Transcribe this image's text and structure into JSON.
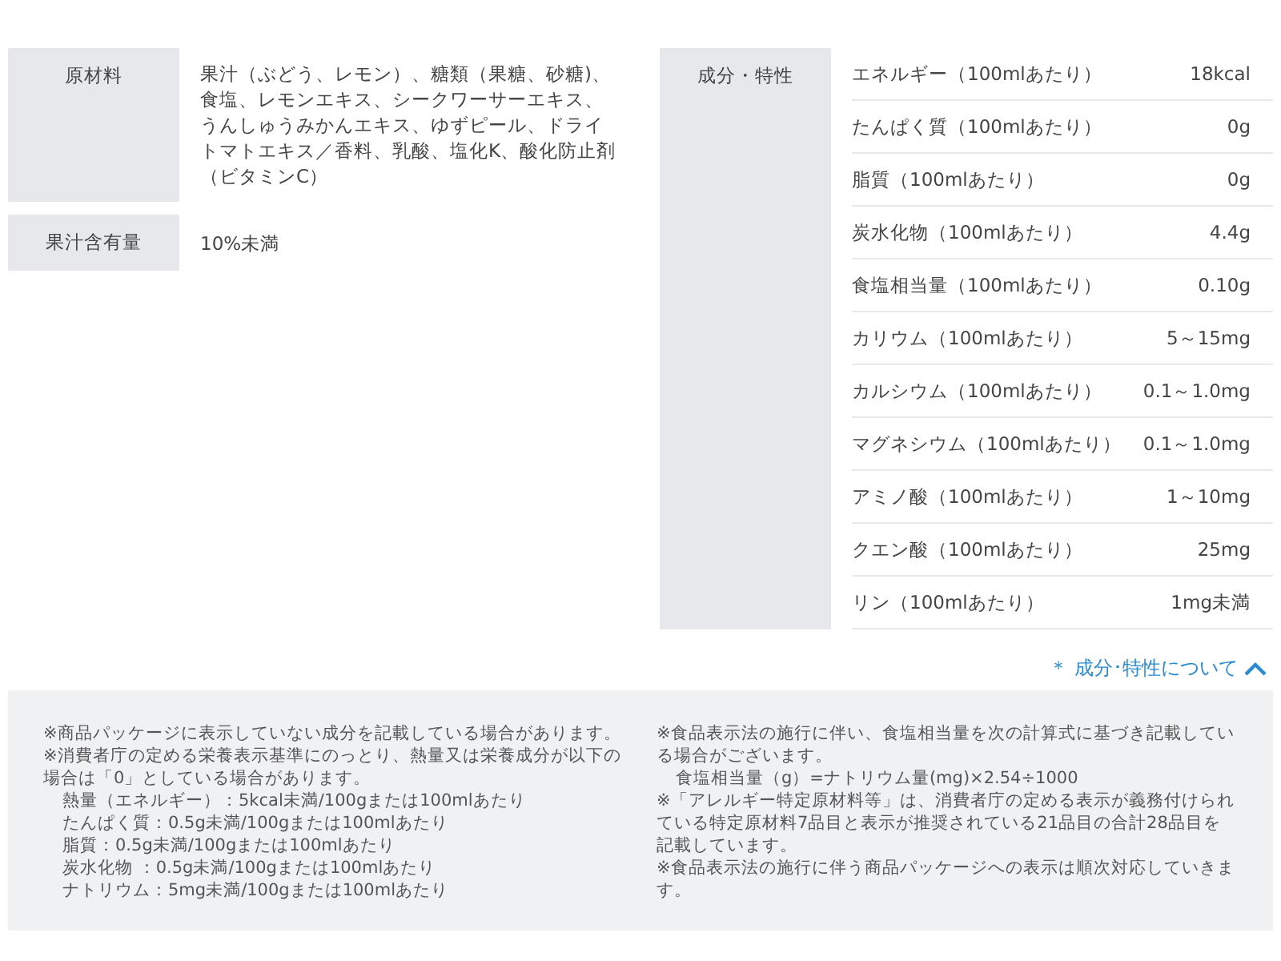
{
  "left_specs": [
    {
      "label": "原材料",
      "value": "果汁（ぶどう、レモン）、糖類（果糖、砂糖)、食塩、レモンエキス、シークワーサーエキス、うんしゅうみかんエキス、ゆずピール、ドライトマトエキス／香料、乳酸、塩化K、酸化防止剤（ビタミンC）"
    },
    {
      "label": "果汁含有量",
      "value": "10%未満"
    }
  ],
  "nutrition": {
    "label": "成分・特性",
    "rows": [
      {
        "name": "エネルギー（100mlあたり）",
        "value": "18kcal"
      },
      {
        "name": "たんぱく質（100mlあたり）",
        "value": "0g"
      },
      {
        "name": "脂質（100mlあたり）",
        "value": "0g"
      },
      {
        "name": "炭水化物（100mlあたり）",
        "value": "4.4g"
      },
      {
        "name": "食塩相当量（100mlあたり）",
        "value": "0.10g"
      },
      {
        "name": "カリウム（100mlあたり）",
        "value": "5～15mg"
      },
      {
        "name": "カルシウム（100mlあたり）",
        "value": "0.1～1.0mg"
      },
      {
        "name": "マグネシウム（100mlあたり）",
        "value": "0.1～1.0mg"
      },
      {
        "name": "アミノ酸（100mlあたり）",
        "value": "1～10mg"
      },
      {
        "name": "クエン酸（100mlあたり）",
        "value": "25mg"
      },
      {
        "name": "リン（100mlあたり）",
        "value": "1mg未満"
      }
    ]
  },
  "about_toggle": {
    "label": "＊ 成分･特性について",
    "expanded": true
  },
  "notes": {
    "left": [
      {
        "kind": "para",
        "text": "※商品パッケージに表示していない成分を記載している場合があります。"
      },
      {
        "kind": "para",
        "text": "※消費者庁の定める栄養表示基準にのっとり、熱量又は栄養成分が以下の場合は「0」としている場合があります。"
      },
      {
        "kind": "indent",
        "text": "熱量（エネルギー）：5kcal未満/100gまたは100mlあたり"
      },
      {
        "kind": "indent",
        "text": "たんぱく質：0.5g未満/100gまたは100mlあたり"
      },
      {
        "kind": "indent",
        "text": "脂質：0.5g未満/100gまたは100mlあたり"
      },
      {
        "kind": "indent",
        "text": "炭水化物 ：0.5g未満/100gまたは100mlあたり"
      },
      {
        "kind": "indent",
        "text": "ナトリウム：5mg未満/100gまたは100mlあたり"
      }
    ],
    "right": [
      {
        "kind": "para",
        "text": "※食品表示法の施行に伴い、食塩相当量を次の計算式に基づき記載している場合がございます。"
      },
      {
        "kind": "indent",
        "text": "食塩相当量（g）=ナトリウム量(mg)×2.54÷1000"
      },
      {
        "kind": "para",
        "text": "※「アレルギー特定原材料等」は、消費者庁の定める表示が義務付けられている特定原材料7品目と表示が推奨されている21品目の合計28品目を記載しています。"
      },
      {
        "kind": "para",
        "text": "※食品表示法の施行に伴う商品パッケージへの表示は順次対応していきます。"
      }
    ]
  }
}
